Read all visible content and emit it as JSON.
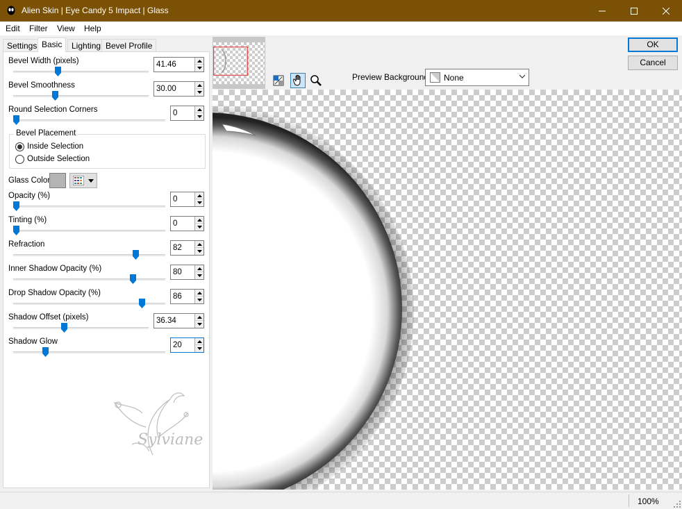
{
  "window": {
    "title": "Alien Skin | Eye Candy 5 Impact | Glass",
    "title_bar_color": "#7b5106"
  },
  "menu": [
    "Edit",
    "Filter",
    "View",
    "Help"
  ],
  "tabs": [
    "Settings",
    "Basic",
    "Lighting",
    "Bevel Profile"
  ],
  "active_tab": "Basic",
  "controls": {
    "bevel_width": {
      "label": "Bevel Width (pixels)",
      "value": "41.46",
      "slider_fraction": 0.32
    },
    "bevel_smoothness": {
      "label": "Bevel Smoothness",
      "value": "30.00",
      "slider_fraction": 0.3
    },
    "round_corners": {
      "label": "Round Selection Corners",
      "value": "0",
      "slider_fraction": 0.0
    },
    "bevel_placement": {
      "legend": "Bevel Placement",
      "options": [
        "Inside Selection",
        "Outside Selection"
      ],
      "selected": "Inside Selection"
    },
    "glass_color": {
      "label": "Glass Color",
      "swatch": "#b4b4b4"
    },
    "opacity": {
      "label": "Opacity (%)",
      "value": "0",
      "slider_fraction": 0.0
    },
    "tinting": {
      "label": "Tinting (%)",
      "value": "0",
      "slider_fraction": 0.0
    },
    "refraction": {
      "label": "Refraction",
      "value": "82",
      "slider_fraction": 0.82
    },
    "inner_shadow_opacity": {
      "label": "Inner Shadow Opacity (%)",
      "value": "80",
      "slider_fraction": 0.8
    },
    "drop_shadow_opacity": {
      "label": "Drop Shadow Opacity (%)",
      "value": "86",
      "slider_fraction": 0.86
    },
    "shadow_offset": {
      "label": "Shadow Offset (pixels)",
      "value": "36.34",
      "slider_fraction": 0.37
    },
    "shadow_glow": {
      "label": "Shadow Glow",
      "value": "20",
      "slider_fraction": 0.2
    }
  },
  "watermark_text": "Sylviane",
  "preview": {
    "background_label": "Preview Background:",
    "background_value": "None",
    "tools": [
      "preview-toggle-icon",
      "hand-icon",
      "zoom-icon"
    ]
  },
  "buttons": {
    "ok": "OK",
    "cancel": "Cancel"
  },
  "status": {
    "zoom": "100%"
  },
  "accent_color": "#0078d7"
}
